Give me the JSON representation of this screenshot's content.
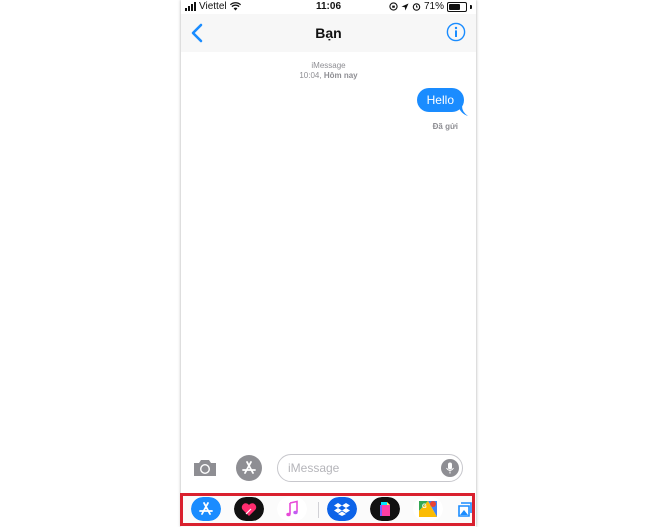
{
  "status_bar": {
    "carrier": "Viettel",
    "time": "11:06",
    "battery_percent": "71%",
    "battery_level": 0.71
  },
  "navbar": {
    "title": "Bạn",
    "back_icon": "chevron-left-icon",
    "info_icon": "info-icon"
  },
  "conversation": {
    "service_label": "iMessage",
    "timestamp_time": "10:04, ",
    "timestamp_day": "Hôm nay",
    "messages": [
      {
        "text": "Hello",
        "direction": "outgoing",
        "status": "Đã gửi"
      }
    ]
  },
  "composer": {
    "placeholder": "iMessage",
    "camera_icon": "camera-icon",
    "apps_icon": "app-store-icon",
    "mic_icon": "microphone-icon"
  },
  "app_drawer": {
    "apps": [
      {
        "name": "app-store-icon"
      },
      {
        "name": "digital-touch-icon"
      },
      {
        "name": "music-icon"
      },
      {
        "name": "dropbox-icon"
      },
      {
        "name": "gif-keyboard-icon"
      },
      {
        "name": "google-maps-icon"
      },
      {
        "name": "photos-app-icon"
      }
    ],
    "highlight_color": "#d9202e"
  },
  "colors": {
    "accent": "#1a8cff",
    "meta_text": "#8e8e93",
    "nav_background": "#f7f7f7"
  }
}
